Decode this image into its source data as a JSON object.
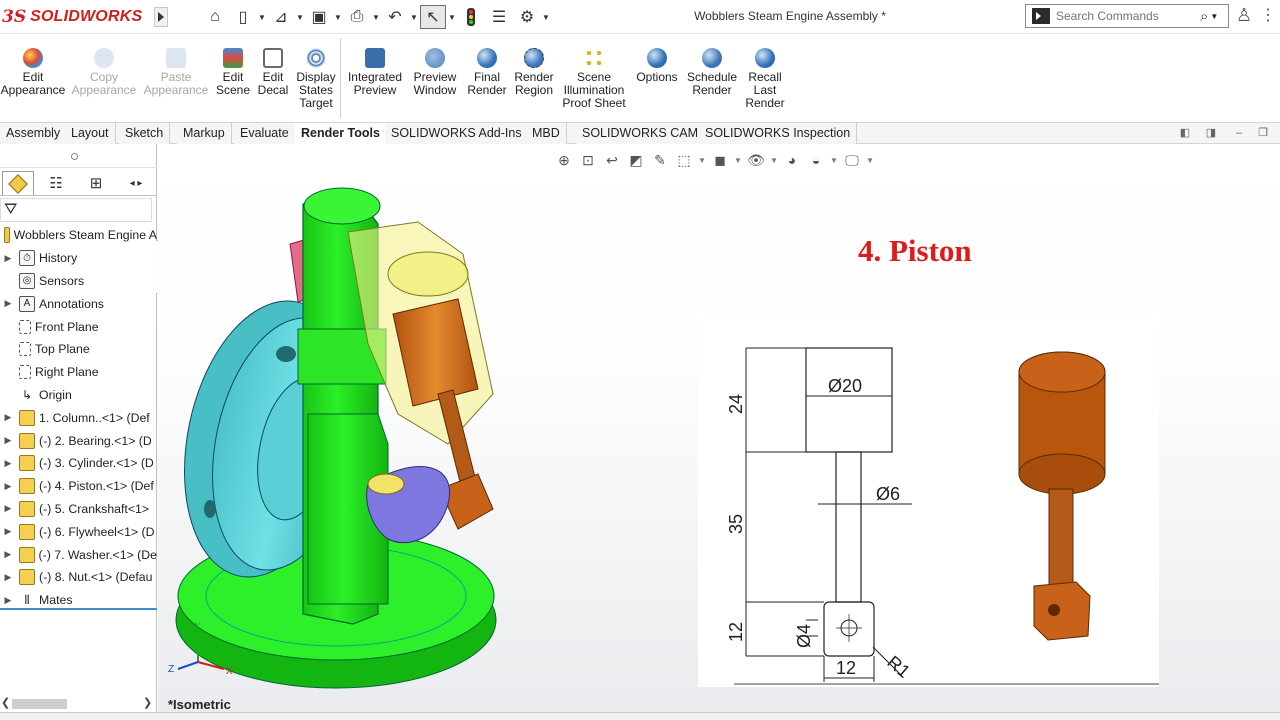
{
  "app": {
    "logo_prefix": "3S",
    "logo_text": "SOLIDWORKS"
  },
  "window": {
    "title": "Wobblers Steam Engine Assembly *"
  },
  "search": {
    "placeholder": "Search Commands"
  },
  "quick_access": [
    {
      "icon": "home-icon",
      "glyph": "⌂"
    },
    {
      "icon": "new-document-icon",
      "glyph": "🗋"
    },
    {
      "icon": "open-folder-icon",
      "glyph": "📂"
    },
    {
      "icon": "save-icon",
      "glyph": "💾"
    },
    {
      "icon": "print-icon",
      "glyph": "🖶"
    },
    {
      "icon": "undo-icon",
      "glyph": "↶"
    },
    {
      "icon": "select-cursor-icon",
      "glyph": "↖"
    },
    {
      "icon": "traffic-light-icon",
      "glyph": "●"
    },
    {
      "icon": "file-properties-icon",
      "glyph": "☰"
    },
    {
      "icon": "options-gear-icon",
      "glyph": "⚙"
    }
  ],
  "ribbon": {
    "buttons": [
      {
        "id": "edit-appearance",
        "lines": [
          "Edit",
          "Appearance"
        ],
        "disabled": false,
        "color": "#e04a3a"
      },
      {
        "id": "copy-appearance",
        "lines": [
          "Copy",
          "Appearance"
        ],
        "disabled": true,
        "color": "#9bb8d8"
      },
      {
        "id": "paste-appearance",
        "lines": [
          "Paste",
          "Appearance"
        ],
        "disabled": true,
        "color": "#9bb8d8"
      },
      {
        "id": "edit-scene",
        "lines": [
          "Edit",
          "Scene"
        ],
        "disabled": false,
        "color": "#3a8ed6"
      },
      {
        "id": "edit-decal",
        "lines": [
          "Edit",
          "Decal"
        ],
        "disabled": false,
        "color": "#6a6a6a"
      },
      {
        "id": "display-states-target",
        "lines": [
          "Display",
          "States",
          "Target"
        ],
        "disabled": false,
        "color": "#3a6fb0"
      },
      {
        "id": "integrated-preview",
        "lines": [
          "Integrated",
          "Preview"
        ],
        "disabled": false,
        "color": "#3b6ea8"
      },
      {
        "id": "preview-window",
        "lines": [
          "Preview",
          "Window"
        ],
        "disabled": false,
        "color": "#4d7fb4"
      },
      {
        "id": "final-render",
        "lines": [
          "Final",
          "Render"
        ],
        "disabled": false,
        "color": "#2f6fb5"
      },
      {
        "id": "render-region",
        "lines": [
          "Render",
          "Region"
        ],
        "disabled": false,
        "color": "#3c78bd"
      },
      {
        "id": "scene-illumination-proof-sheet",
        "lines": [
          "Scene",
          "Illumination",
          "Proof Sheet"
        ],
        "disabled": false,
        "color": "#e0b020"
      },
      {
        "id": "options",
        "lines": [
          "Options"
        ],
        "disabled": false,
        "color": "#2d6db3"
      },
      {
        "id": "schedule-render",
        "lines": [
          "Schedule",
          "Render"
        ],
        "disabled": false,
        "color": "#3a74b5"
      },
      {
        "id": "recall-last-render",
        "lines": [
          "Recall",
          "Last",
          "Render"
        ],
        "disabled": false,
        "color": "#2d6db3"
      }
    ]
  },
  "tabs": [
    {
      "label": "Assembly",
      "active": false
    },
    {
      "label": "Layout",
      "active": false
    },
    {
      "label": "Sketch",
      "active": false
    },
    {
      "label": "Markup",
      "active": false
    },
    {
      "label": "Evaluate",
      "active": false
    },
    {
      "label": "Render Tools",
      "active": true
    },
    {
      "label": "SOLIDWORKS Add-Ins",
      "active": false
    },
    {
      "label": "MBD",
      "active": false
    },
    {
      "label": "SOLIDWORKS CAM",
      "active": false
    },
    {
      "label": "SOLIDWORKS Inspection",
      "active": false
    }
  ],
  "tree": {
    "root": "Wobblers Steam Engine A",
    "items": [
      {
        "label": "History",
        "expandable": true,
        "icon": "history-icon"
      },
      {
        "label": "Sensors",
        "expandable": false,
        "icon": "sensors-icon"
      },
      {
        "label": "Annotations",
        "expandable": true,
        "icon": "annotations-icon"
      },
      {
        "label": "Front Plane",
        "expandable": false,
        "icon": "plane-icon"
      },
      {
        "label": "Top Plane",
        "expandable": false,
        "icon": "plane-icon"
      },
      {
        "label": "Right Plane",
        "expandable": false,
        "icon": "plane-icon"
      },
      {
        "label": "Origin",
        "expandable": false,
        "icon": "origin-icon"
      },
      {
        "label": "1. Column..<1> (Def",
        "expandable": true,
        "icon": "part-icon"
      },
      {
        "label": "(-) 2. Bearing.<1> (D",
        "expandable": true,
        "icon": "part-icon"
      },
      {
        "label": "(-) 3. Cylinder.<1> (D",
        "expandable": true,
        "icon": "part-icon"
      },
      {
        "label": "(-) 4. Piston.<1> (Def",
        "expandable": true,
        "icon": "part-icon"
      },
      {
        "label": "(-) 5. Crankshaft<1>",
        "expandable": true,
        "icon": "part-icon"
      },
      {
        "label": "(-) 6. Flywheel<1> (D",
        "expandable": true,
        "icon": "part-icon"
      },
      {
        "label": "(-) 7. Washer.<1> (De",
        "expandable": true,
        "icon": "part-icon"
      },
      {
        "label": "(-) 8. Nut.<1> (Defau",
        "expandable": true,
        "icon": "part-icon"
      },
      {
        "label": "Mates",
        "expandable": true,
        "icon": "mates-icon"
      }
    ]
  },
  "graphics": {
    "overlay_title": "4. Piston",
    "view_label": "*Isometric",
    "triad": {
      "x": "X",
      "y": "Y",
      "z": "Z"
    },
    "drawing": {
      "dims": {
        "height_top": "24",
        "height_rod": "35",
        "height_bottom": "12",
        "dia_head": "Ø20",
        "dia_rod": "Ø6",
        "dia_hole": "Ø4",
        "width_bottom": "12",
        "radius": "R1"
      }
    }
  },
  "colors": {
    "brand": "#d21d1d",
    "overlay_title": "#e01b1b",
    "column_green": "#22e51e",
    "flywheel_cyan": "#5fd3d8",
    "piston_orange": "#c8621a",
    "crank_purple": "#7f77e0",
    "cylinder_yellow": "#f3f08c"
  }
}
